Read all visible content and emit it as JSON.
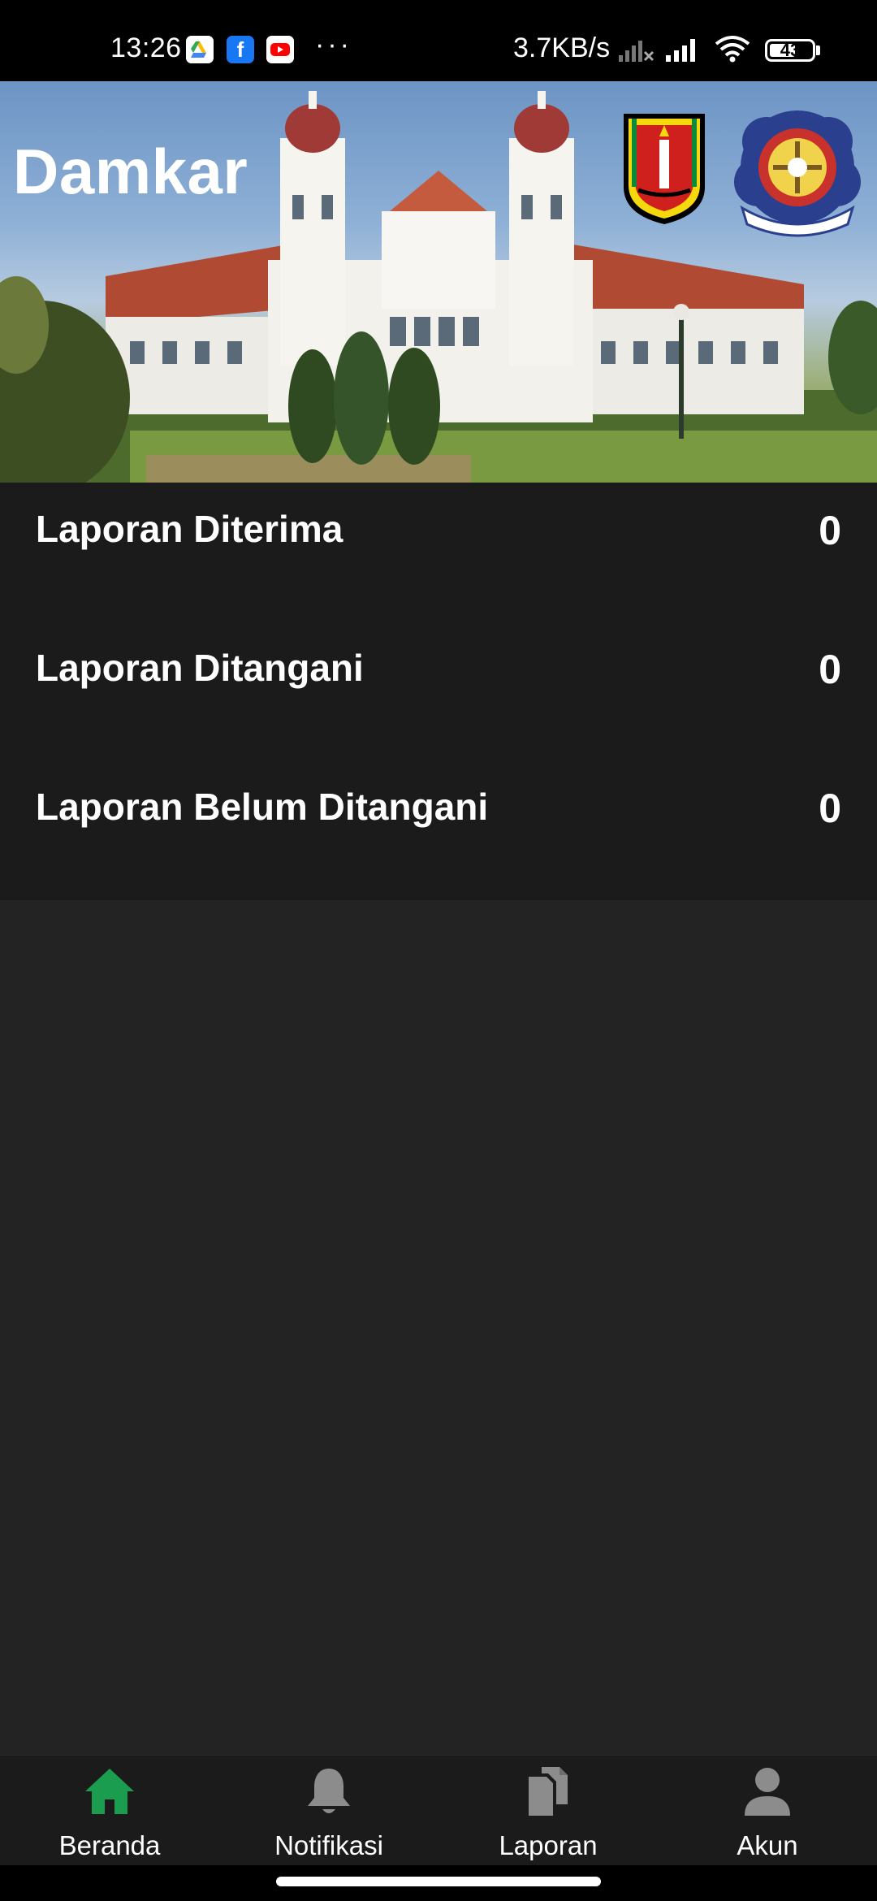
{
  "status_bar": {
    "time": "13:26",
    "network_speed": "3.7KB/s",
    "battery": "43",
    "more": "···",
    "notification_icons": [
      "google-drive-icon",
      "facebook-icon",
      "youtube-icon"
    ],
    "system_icons": [
      "no-signal-icon",
      "signal-icon",
      "wifi-icon",
      "battery-icon"
    ]
  },
  "header": {
    "title": "Damkar",
    "logos": [
      "city-crest-logo",
      "fire-department-emblem"
    ]
  },
  "stats": [
    {
      "label": "Laporan Diterima",
      "value": "0"
    },
    {
      "label": "Laporan Ditangani",
      "value": "0"
    },
    {
      "label": "Laporan Belum Ditangani",
      "value": "0"
    }
  ],
  "bottom_nav": {
    "items": [
      {
        "label": "Beranda",
        "icon": "home-icon",
        "active": true
      },
      {
        "label": "Notifikasi",
        "icon": "bell-icon",
        "active": false
      },
      {
        "label": "Laporan",
        "icon": "documents-icon",
        "active": false
      },
      {
        "label": "Akun",
        "icon": "user-icon",
        "active": false
      }
    ]
  },
  "colors": {
    "accent": "#1a9d4f",
    "background": "#232323",
    "panel": "#1b1b1b",
    "inactive_icon": "#8c8c8c"
  }
}
